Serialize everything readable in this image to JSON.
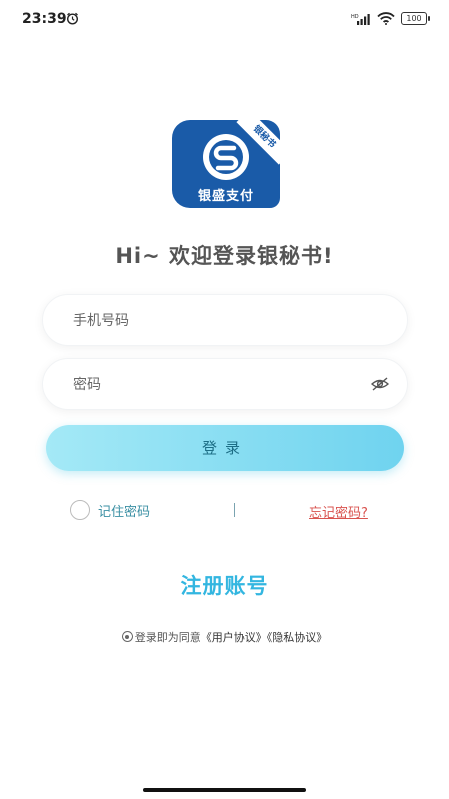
{
  "status_bar": {
    "time": "23:39",
    "battery": "100"
  },
  "logo": {
    "tag": "银秘书",
    "brand_text": "银盛支付"
  },
  "welcome_text": "Hi~ 欢迎登录银秘书!",
  "form": {
    "phone_placeholder": "手机号码",
    "password_placeholder": "密码",
    "login_label": "登录",
    "remember_label": "记住密码",
    "forgot_label": "忘记密码?"
  },
  "register_label": "注册账号",
  "agreement": {
    "prefix": "登录即为同意",
    "user_agreement": "《用户协议》",
    "privacy_agreement": "《隐私协议》"
  },
  "colors": {
    "brand_blue": "#1a5ba8",
    "login_button": "#6fd3ef",
    "register_text": "#33b6e0",
    "forgot_text": "#d9534f"
  }
}
